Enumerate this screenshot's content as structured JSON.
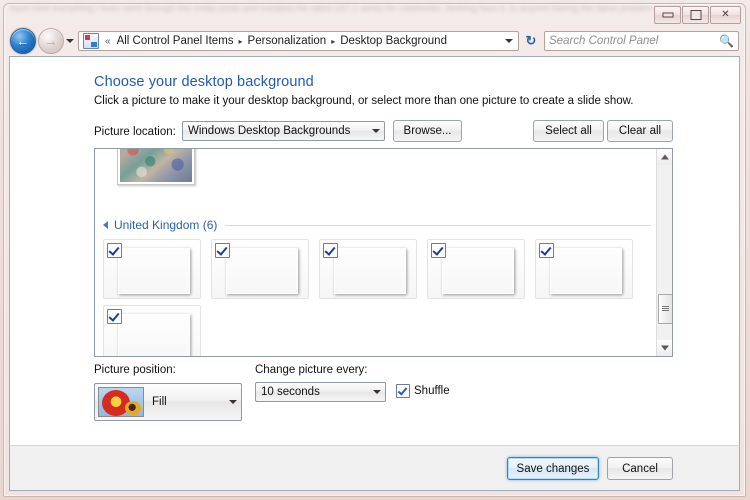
{
  "background": {
    "faded_text": "have tried everything I even went through the nvidia posts and installed the latest 197.1 series for notebooks. Nothing fixes it. Is anyone having the same problem as me?"
  },
  "window": {
    "controls": {
      "minimize": "minimize-button",
      "maximize": "maximize-button",
      "close": "close-button"
    }
  },
  "navigation": {
    "back": "Back",
    "forward": "Forward",
    "recent_pages": "Recent Pages",
    "breadcrumb_overflow": "«",
    "breadcrumbs": [
      {
        "label": "All Control Panel Items"
      },
      {
        "label": "Personalization"
      },
      {
        "label": "Desktop Background"
      }
    ],
    "separator": "▸",
    "refresh": "Refresh",
    "address_dropdown": "Previous Locations"
  },
  "search": {
    "placeholder": "Search Control Panel",
    "icon": "search-icon"
  },
  "page": {
    "heading": "Choose your desktop background",
    "subheading": "Click a picture to make it your desktop background, or select more than one picture to create a slide show."
  },
  "picture_location": {
    "label": "Picture location:",
    "selected": "Windows Desktop Backgrounds",
    "browse_label": "Browse...",
    "select_all_label": "Select all",
    "clear_all_label": "Clear all"
  },
  "gallery": {
    "group": {
      "title": "United Kingdom (6)",
      "expanded": true
    },
    "partial_thumbnail": {
      "name": "partial-thumbnail-above",
      "art": "art-partial"
    },
    "thumbnails": [
      {
        "name": "thumbnail-stonehenge",
        "art": "art-stonehenge",
        "checked": true
      },
      {
        "name": "thumbnail-london-bridge",
        "art": "art-london",
        "checked": true
      },
      {
        "name": "thumbnail-loch-sunrise",
        "art": "art-loch",
        "checked": true
      },
      {
        "name": "thumbnail-giants-causeway",
        "art": "art-causeway",
        "checked": true
      },
      {
        "name": "thumbnail-coastal-castle",
        "art": "art-castle",
        "checked": true
      },
      {
        "name": "thumbnail-white-cliffs",
        "art": "art-cliffs",
        "checked": true
      }
    ],
    "scrollbar": {
      "up": "scroll-up",
      "down": "scroll-down",
      "thumb_position_percent": 72
    }
  },
  "picture_position": {
    "label": "Picture position:",
    "selected": "Fill"
  },
  "change_picture": {
    "label": "Change picture every:",
    "selected": "10 seconds"
  },
  "shuffle": {
    "label": "Shuffle",
    "checked": true
  },
  "footer": {
    "save_label": "Save changes",
    "cancel_label": "Cancel"
  },
  "colors": {
    "heading_blue": "#1f5bb5",
    "group_blue": "#2a62b0",
    "accent_default_button": "#3c7fb1",
    "frame_tint": "#cbb6b1"
  }
}
